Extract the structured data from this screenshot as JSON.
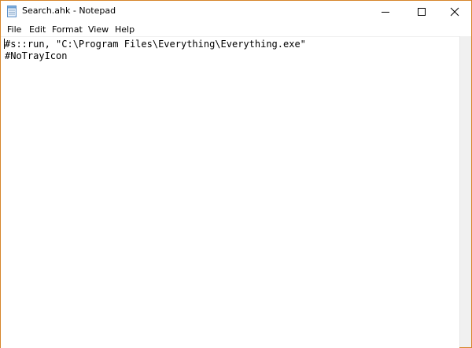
{
  "window": {
    "title": "Search.ahk - Notepad",
    "border_color": "#d6862a"
  },
  "icons": {
    "app": "notepad-icon",
    "minimize": "minimize-icon",
    "maximize": "maximize-icon",
    "close": "close-icon"
  },
  "menu": {
    "items": [
      {
        "label": "File"
      },
      {
        "label": "Edit"
      },
      {
        "label": "Format"
      },
      {
        "label": "View"
      },
      {
        "label": "Help"
      }
    ]
  },
  "editor": {
    "lines": [
      "#s::run, \"C:\\Program Files\\Everything\\Everything.exe\"",
      "#NoTrayIcon"
    ]
  }
}
